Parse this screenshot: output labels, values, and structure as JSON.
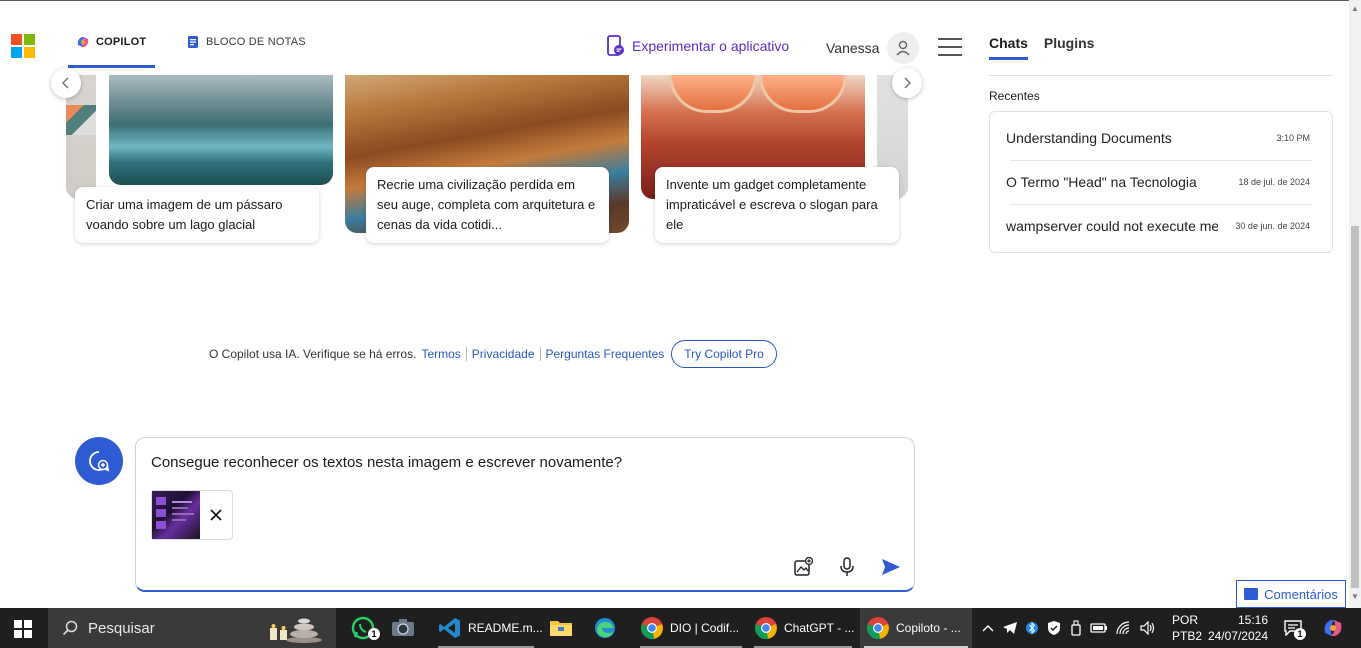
{
  "header": {
    "tabs": [
      {
        "label": "COPILOT",
        "active": true
      },
      {
        "label": "BLOCO DE NOTAS",
        "active": false
      }
    ],
    "try_app_label": "Experimentar o aplicativo",
    "user_name": "Vanessa"
  },
  "carousel": {
    "cards": [
      {
        "text": "Criar uma imagem de um pássaro voando sobre um lago glacial"
      },
      {
        "text": "Recrie uma civilização perdida em seu auge, completa com arquitetura e cenas da vida cotidi..."
      },
      {
        "text": "Invente um gadget completamente impraticável e escreva o slogan para ele"
      }
    ]
  },
  "footer": {
    "disclaimer": "O Copilot usa IA. Verifique se há erros.",
    "links": [
      "Termos",
      "Privacidade",
      "Perguntas Frequentes"
    ],
    "pro_button": "Try Copilot Pro"
  },
  "composer": {
    "text": "Consegue reconhecer os textos nesta imagem e escrever novamente?"
  },
  "sidebar": {
    "tabs": [
      {
        "label": "Chats",
        "active": true
      },
      {
        "label": "Plugins",
        "active": false
      }
    ],
    "recent_label": "Recentes",
    "recent_items": [
      {
        "title": "Understanding Documents",
        "date": "3:10 PM"
      },
      {
        "title": "O Termo \"Head\" na Tecnologia",
        "date": "18 de jul. de 2024"
      },
      {
        "title": "wampserver could not execute menu",
        "date": "30 de jun. de 2024"
      }
    ]
  },
  "feedback_label": "Comentários",
  "taskbar": {
    "search_placeholder": "Pesquisar",
    "apps": [
      {
        "label": "README.m..."
      },
      {
        "label": "DIO | Codif..."
      },
      {
        "label": "ChatGPT - ..."
      },
      {
        "label": "Copiloto - ..."
      }
    ],
    "whatsapp_badge": "1",
    "notification_badge": "1",
    "lang_line1": "POR",
    "lang_line2": "PTB2",
    "time": "15:16",
    "date": "24/07/2024"
  },
  "colors": {
    "accent": "#2f5bd3",
    "purple": "#5b2ec7",
    "taskbar": "#1f1f1f"
  }
}
